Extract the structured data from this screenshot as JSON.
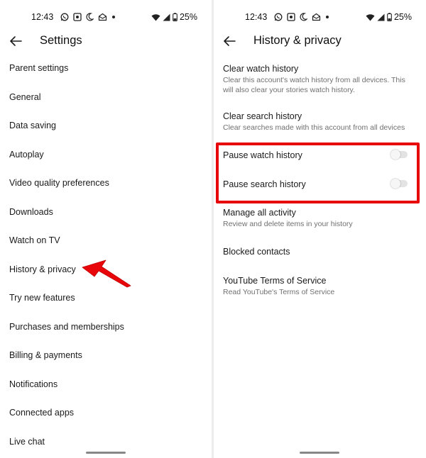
{
  "status": {
    "time": "12:43",
    "battery": "25%"
  },
  "left": {
    "title": "Settings",
    "items": [
      {
        "label": "Parent settings"
      },
      {
        "label": "General"
      },
      {
        "label": "Data saving"
      },
      {
        "label": "Autoplay"
      },
      {
        "label": "Video quality preferences"
      },
      {
        "label": "Downloads"
      },
      {
        "label": "Watch on TV"
      },
      {
        "label": "History & privacy"
      },
      {
        "label": "Try new features"
      },
      {
        "label": "Purchases and memberships"
      },
      {
        "label": "Billing & payments"
      },
      {
        "label": "Notifications"
      },
      {
        "label": "Connected apps"
      },
      {
        "label": "Live chat"
      }
    ]
  },
  "right": {
    "title": "History & privacy",
    "items": [
      {
        "title": "Clear watch history",
        "subtitle": "Clear this account's watch history from all devices. This will also clear your stories watch history."
      },
      {
        "title": "Clear search history",
        "subtitle": "Clear searches made with this account from all devices"
      },
      {
        "title": "Pause watch history",
        "toggle_on": false
      },
      {
        "title": "Pause search history",
        "toggle_on": false
      },
      {
        "title": "Manage all activity",
        "subtitle": "Review and delete items in your history"
      },
      {
        "title": "Blocked contacts"
      },
      {
        "title": "YouTube Terms of Service",
        "subtitle": "Read YouTube's Terms of Service"
      }
    ]
  },
  "annotation": {
    "arrow_color": "#e8060b",
    "box_color": "#e8060b"
  }
}
